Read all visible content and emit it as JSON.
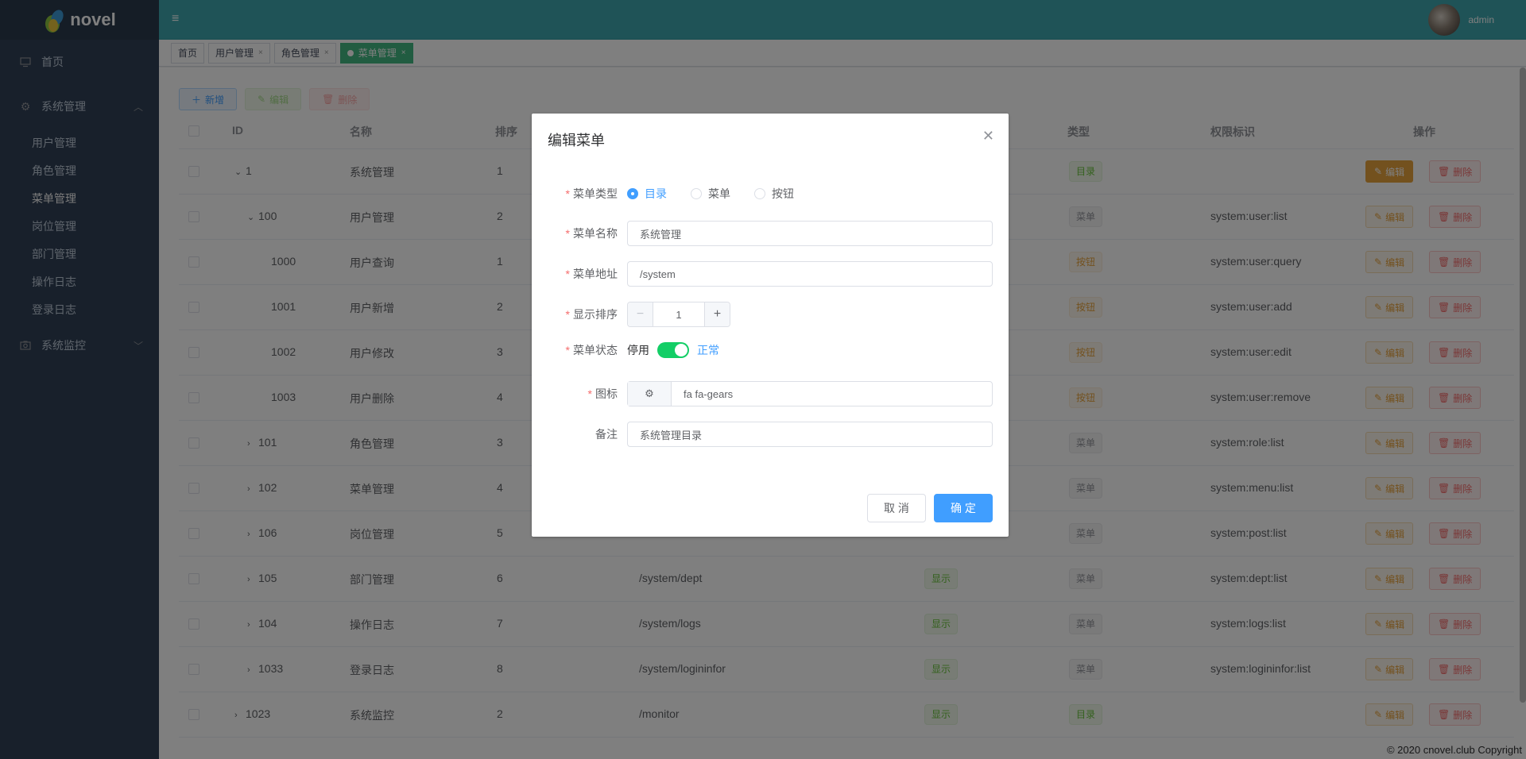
{
  "app": {
    "logo": "novel",
    "user": "admin"
  },
  "sidebar": {
    "home": "首页",
    "system": "系统管理",
    "sub_items": [
      "用户管理",
      "角色管理",
      "菜单管理",
      "岗位管理",
      "部门管理",
      "操作日志",
      "登录日志"
    ],
    "monitor": "系统监控"
  },
  "tags": {
    "home": "首页",
    "t1": "用户管理",
    "t2": "角色管理",
    "t3": "菜单管理"
  },
  "toolbar": {
    "add": "新增",
    "edit": "编辑",
    "delete": "删除"
  },
  "table": {
    "headers": {
      "id": "ID",
      "name": "名称",
      "sort": "排序",
      "type": "类型",
      "perm": "权限标识",
      "op": "操作"
    },
    "rows": [
      {
        "id": "1",
        "name": "系统管理",
        "sort": "1",
        "path": "",
        "visible": "",
        "type": "目录",
        "perm": ""
      },
      {
        "id": "100",
        "name": "用户管理",
        "sort": "2",
        "path": "",
        "visible": "",
        "type": "菜单",
        "perm": "system:user:list"
      },
      {
        "id": "1000",
        "name": "用户查询",
        "sort": "1",
        "path": "",
        "visible": "",
        "type": "按钮",
        "perm": "system:user:query"
      },
      {
        "id": "1001",
        "name": "用户新增",
        "sort": "2",
        "path": "",
        "visible": "",
        "type": "按钮",
        "perm": "system:user:add"
      },
      {
        "id": "1002",
        "name": "用户修改",
        "sort": "3",
        "path": "",
        "visible": "",
        "type": "按钮",
        "perm": "system:user:edit"
      },
      {
        "id": "1003",
        "name": "用户删除",
        "sort": "4",
        "path": "",
        "visible": "",
        "type": "按钮",
        "perm": "system:user:remove"
      },
      {
        "id": "101",
        "name": "角色管理",
        "sort": "3",
        "path": "",
        "visible": "",
        "type": "菜单",
        "perm": "system:role:list"
      },
      {
        "id": "102",
        "name": "菜单管理",
        "sort": "4",
        "path": "",
        "visible": "",
        "type": "菜单",
        "perm": "system:menu:list"
      },
      {
        "id": "106",
        "name": "岗位管理",
        "sort": "5",
        "path": "",
        "visible": "",
        "type": "菜单",
        "perm": "system:post:list"
      },
      {
        "id": "105",
        "name": "部门管理",
        "sort": "6",
        "path": "/system/dept",
        "visible": "显示",
        "type": "菜单",
        "perm": "system:dept:list"
      },
      {
        "id": "104",
        "name": "操作日志",
        "sort": "7",
        "path": "/system/logs",
        "visible": "显示",
        "type": "菜单",
        "perm": "system:logs:list"
      },
      {
        "id": "1033",
        "name": "登录日志",
        "sort": "8",
        "path": "/system/logininfor",
        "visible": "显示",
        "type": "菜单",
        "perm": "system:logininfor:list"
      },
      {
        "id": "1023",
        "name": "系统监控",
        "sort": "2",
        "path": "/monitor",
        "visible": "显示",
        "type": "目录",
        "perm": ""
      }
    ],
    "op_edit": "编辑",
    "op_delete": "删除"
  },
  "dialog": {
    "title": "编辑菜单",
    "labels": {
      "type": "菜单类型",
      "name": "菜单名称",
      "path": "菜单地址",
      "sort": "显示排序",
      "status": "菜单状态",
      "icon": "图标",
      "remark": "备注"
    },
    "type_options": [
      "目录",
      "菜单",
      "按钮"
    ],
    "selected_type": "目录",
    "name_value": "系统管理",
    "path_value": "/system",
    "sort_value": "1",
    "status_off": "停用",
    "status_on": "正常",
    "icon_value": "fa fa-gears",
    "remark_value": "系统管理目录",
    "cancel": "取 消",
    "ok": "确 定"
  },
  "footer": "© 2020 cnovel.club Copyright"
}
